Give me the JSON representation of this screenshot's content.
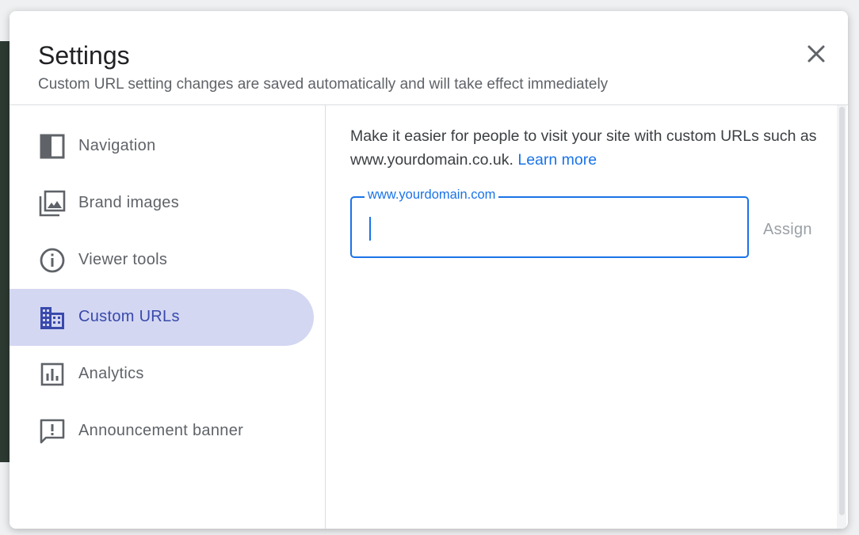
{
  "dialog": {
    "title": "Settings",
    "subtitle": "Custom URL setting changes are saved automatically and will take effect immediately"
  },
  "sidebar": {
    "items": [
      {
        "label": "Navigation",
        "icon": "navigation-panel-icon",
        "active": false
      },
      {
        "label": "Brand images",
        "icon": "photo-library-icon",
        "active": false
      },
      {
        "label": "Viewer tools",
        "icon": "info-icon",
        "active": false
      },
      {
        "label": "Custom URLs",
        "icon": "domain-building-icon",
        "active": true
      },
      {
        "label": "Analytics",
        "icon": "analytics-chart-icon",
        "active": false
      },
      {
        "label": "Announcement banner",
        "icon": "announcement-icon",
        "active": false
      }
    ]
  },
  "content": {
    "description": "Make it easier for people to visit your site with custom URLs such as www.yourdomain.co.uk.",
    "learn_more": "Learn more",
    "url_field": {
      "label": "www.yourdomain.com",
      "value": ""
    },
    "assign_label": "Assign"
  },
  "colors": {
    "accent": "#1a73e8",
    "active_bg": "#d3d7f2",
    "active_text": "#3949ab",
    "muted_text": "#5f6368"
  }
}
